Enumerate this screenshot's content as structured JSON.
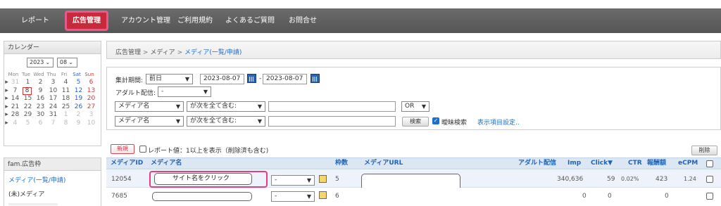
{
  "nav": {
    "items": [
      "レポート",
      "広告管理",
      "アカウント管理",
      "ご利用規約",
      "よくあるご質問",
      "お問合せ"
    ],
    "active_index": 1
  },
  "sidebar": {
    "calendar_title": "カレンダー",
    "year": "2023",
    "month": "08",
    "weekdays": [
      "Mon",
      "Tue",
      "Wed",
      "Thu",
      "Fri",
      "Sat",
      "Sun"
    ],
    "weeks": [
      [
        "31",
        "1",
        "2",
        "3",
        "4",
        "5",
        "6"
      ],
      [
        "7",
        "8",
        "9",
        "10",
        "11",
        "12",
        "13"
      ],
      [
        "14",
        "15",
        "16",
        "17",
        "18",
        "19",
        "20"
      ],
      [
        "21",
        "22",
        "23",
        "24",
        "25",
        "26",
        "27"
      ],
      [
        "28",
        "29",
        "30",
        "31",
        "1",
        "2",
        "3"
      ],
      [
        "4",
        "5",
        "6",
        "7",
        "8",
        "9",
        "10"
      ]
    ],
    "today": "8",
    "section_title": "fam.広告枠",
    "links": [
      "メディア(一覧/申請)",
      "(未)メディア"
    ]
  },
  "breadcrumb": {
    "root": "広告管理",
    "sep": ">",
    "parent": "メディア",
    "current": "メディア(一覧/申請)"
  },
  "filter": {
    "period_label": "集計期間:",
    "period_value": "前日",
    "date_from": "2023-08-07",
    "date_sep": "-",
    "date_to": "2023-08-07",
    "adult_label": "アダルト配信:",
    "adult_value": "-",
    "cond1_field": "メディア名",
    "cond1_op": "が次を全て含む:",
    "cond1_text": "",
    "logic_value": "OR",
    "cond2_field": "メディア名",
    "cond2_op": "が次を全て含む:",
    "cond2_text": "",
    "search_button": "検索",
    "fuzzy_label": "曖昧検索",
    "fuzzy_checked": true,
    "display_settings": "表示項目設定.."
  },
  "list": {
    "new_button": "新規",
    "show_option_label": "レポート値：1以上を表示（削除済も含む)",
    "delete_button": "削除",
    "columns": [
      "メディアID",
      "メディア名",
      "枠数",
      "メディアURL",
      "アダルト配信",
      "Imp",
      "Click▼",
      "CTR",
      "報酬額",
      "eCPM"
    ],
    "rows": [
      {
        "id": "12054",
        "name": "サイト名をクリック",
        "select": "-",
        "slots": "5",
        "url": "",
        "adult": "",
        "imp": "340,636",
        "click": "59",
        "ctr": "0.02%",
        "reward": "423",
        "ecpm": "1.24"
      },
      {
        "id": "7685",
        "name": "",
        "select": "-",
        "slots": "6",
        "url": "",
        "adult": "",
        "imp": "0",
        "click": "0",
        "ctr": "",
        "reward": "0",
        "ecpm": ""
      }
    ]
  },
  "colors": {
    "nav_bg": "#5e5e5e",
    "active_tab": "#c82a3d",
    "highlight": "#e23f7d",
    "link": "#1e6fc9",
    "header_text": "#1c64b7",
    "new_button": "#d1313f"
  }
}
